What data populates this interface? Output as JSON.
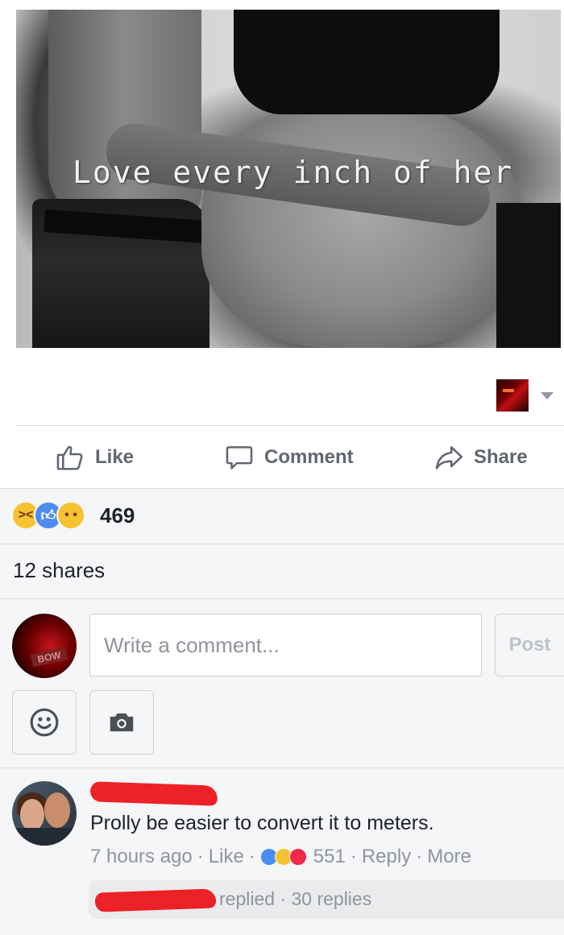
{
  "post": {
    "image_caption": "Love every inch of her"
  },
  "actions": {
    "like_label": "Like",
    "comment_label": "Comment",
    "share_label": "Share"
  },
  "reactions": {
    "icons": [
      "haha-reaction-icon",
      "like-reaction-icon",
      "sad-reaction-icon"
    ],
    "count": "469"
  },
  "shares": {
    "label": "12 shares"
  },
  "composer": {
    "placeholder": "Write a comment...",
    "post_label": "Post",
    "tools": [
      "emoji-icon",
      "camera-icon"
    ]
  },
  "comment": {
    "text": "Prolly be easier to convert it to meters.",
    "time": "7 hours ago",
    "like_label": "Like",
    "reaction_count": "551",
    "reply_label": "Reply",
    "more_label": "More",
    "replies_text": "replied · 30 replies",
    "reaction_icons": [
      "like-reaction-icon",
      "haha-reaction-icon",
      "love-reaction-icon"
    ]
  },
  "colors": {
    "link_grey": "#90949c",
    "action_grey": "#606770",
    "background_grey": "#f5f6f7",
    "redaction_red": "#ec2227",
    "like_blue": "#4c8cf0"
  }
}
